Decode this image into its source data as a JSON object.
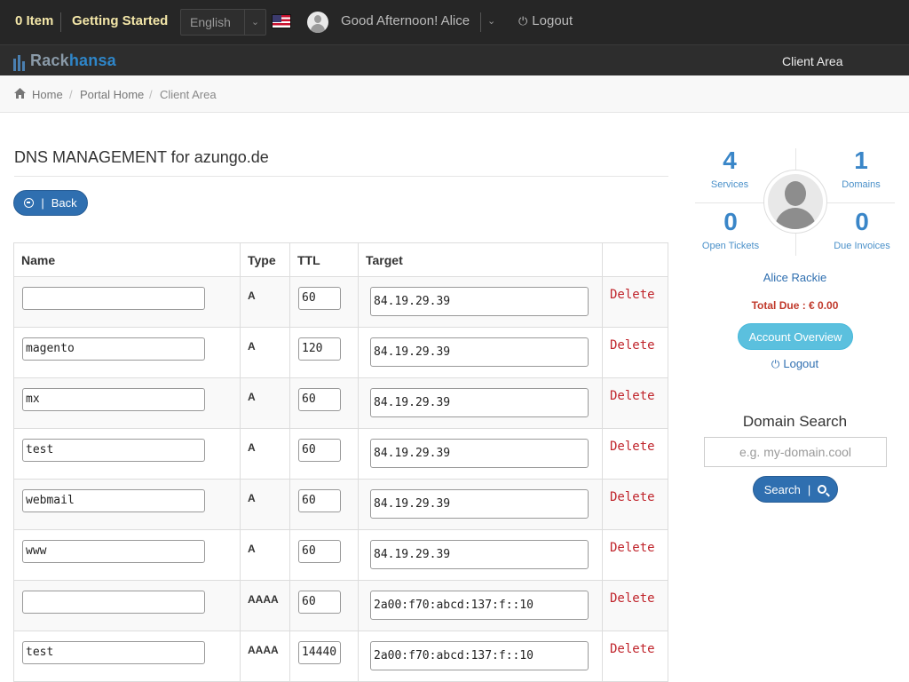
{
  "topbar": {
    "cart": "0 Item",
    "getting_started": "Getting Started",
    "language": "English",
    "greeting": "Good Afternoon! Alice",
    "logout": "Logout"
  },
  "brand": {
    "logo_part1": "Rack",
    "logo_part2": "hansa",
    "nav_client_area": "Client Area"
  },
  "breadcrumb": [
    "Home",
    "Portal Home",
    "Client Area"
  ],
  "page": {
    "title": "DNS MANAGEMENT for azungo.de",
    "back_label": "Back"
  },
  "table": {
    "headers": [
      "Name",
      "Type",
      "TTL",
      "Target"
    ],
    "delete_label": "Delete",
    "rows": [
      {
        "name": "",
        "type": "A",
        "ttl": "60",
        "target": "84.19.29.39"
      },
      {
        "name": "magento",
        "type": "A",
        "ttl": "120",
        "target": "84.19.29.39"
      },
      {
        "name": "mx",
        "type": "A",
        "ttl": "60",
        "target": "84.19.29.39"
      },
      {
        "name": "test",
        "type": "A",
        "ttl": "60",
        "target": "84.19.29.39"
      },
      {
        "name": "webmail",
        "type": "A",
        "ttl": "60",
        "target": "84.19.29.39"
      },
      {
        "name": "www",
        "type": "A",
        "ttl": "60",
        "target": "84.19.29.39"
      },
      {
        "name": "",
        "type": "AAAA",
        "ttl": "60",
        "target": "2a00:f70:abcd:137:f::10"
      },
      {
        "name": "test",
        "type": "AAAA",
        "ttl": "14440",
        "target": "2a00:f70:abcd:137:f::10"
      }
    ]
  },
  "sidebar": {
    "services": {
      "count": "4",
      "label": "Services"
    },
    "domains": {
      "count": "1",
      "label": "Domains"
    },
    "tickets": {
      "count": "0",
      "label": "Open Tickets"
    },
    "invoices": {
      "count": "0",
      "label": "Due Invoices"
    },
    "user_name": "Alice Rackie",
    "total_due": "Total Due : € 0.00",
    "account_overview": "Account Overview",
    "logout": "Logout"
  },
  "domain_search": {
    "title": "Domain Search",
    "placeholder": "e.g. my-domain.cool",
    "button": "Search"
  },
  "colors": {
    "primary": "#2f6fb0",
    "info": "#5bc0de",
    "danger": "#c0252c",
    "topbar": "#262626"
  }
}
